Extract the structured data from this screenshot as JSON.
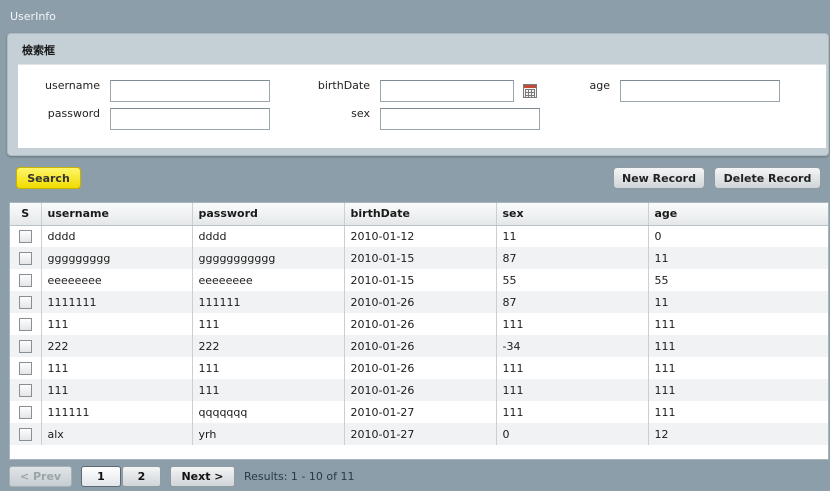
{
  "page": {
    "title": "UserInfo"
  },
  "search_panel": {
    "title": "檢索框",
    "fields": {
      "username": {
        "label": "username",
        "value": ""
      },
      "birthDate": {
        "label": "birthDate",
        "value": ""
      },
      "age": {
        "label": "age",
        "value": ""
      },
      "password": {
        "label": "password",
        "value": ""
      },
      "sex": {
        "label": "sex",
        "value": ""
      }
    },
    "calendar_icon": "calendar-icon"
  },
  "toolbar": {
    "search_label": "Search",
    "new_record_label": "New Record",
    "delete_record_label": "Delete Record"
  },
  "colors": {
    "search_button": "#f0dc00",
    "background": "#8c9ea9",
    "panel": "#c4cfd6",
    "row_alt": "#f0f2f3"
  },
  "table": {
    "columns": [
      "S",
      "username",
      "password",
      "birthDate",
      "sex",
      "age"
    ],
    "rows": [
      [
        "dddd",
        "dddd",
        "2010-01-12",
        "11",
        "0"
      ],
      [
        "ggggggggg",
        "ggggggggggg",
        "2010-01-15",
        "87",
        "11"
      ],
      [
        "eeeeeeee",
        "eeeeeeee",
        "2010-01-15",
        "55",
        "55"
      ],
      [
        "1111111",
        "111111",
        "2010-01-26",
        "87",
        "11"
      ],
      [
        "111",
        "111",
        "2010-01-26",
        "111",
        "111"
      ],
      [
        "222",
        "222",
        "2010-01-26",
        "-34",
        "111"
      ],
      [
        "111",
        "111",
        "2010-01-26",
        "111",
        "111"
      ],
      [
        "111",
        "111",
        "2010-01-26",
        "111",
        "111"
      ],
      [
        "111111",
        "qqqqqqq",
        "2010-01-27",
        "111",
        "111"
      ],
      [
        "alx",
        "yrh",
        "2010-01-27",
        "0",
        "12"
      ]
    ]
  },
  "pagination": {
    "prev_label": "< Prev",
    "pages": [
      "1",
      "2"
    ],
    "current_page": "1",
    "next_label": "Next >",
    "results_text": "Results: 1 - 10 of 11"
  }
}
